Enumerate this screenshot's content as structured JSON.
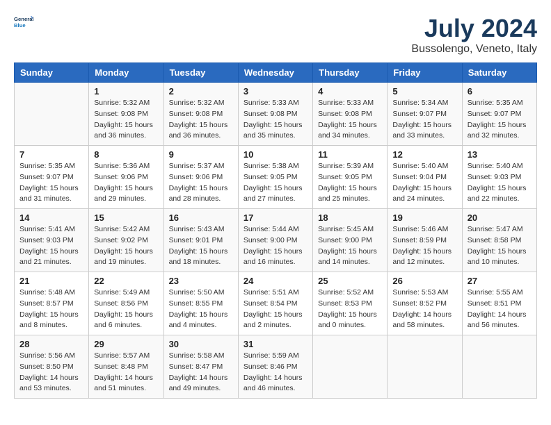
{
  "logo": {
    "line1": "General",
    "line2": "Blue"
  },
  "title": "July 2024",
  "location": "Bussolengo, Veneto, Italy",
  "days_header": [
    "Sunday",
    "Monday",
    "Tuesday",
    "Wednesday",
    "Thursday",
    "Friday",
    "Saturday"
  ],
  "weeks": [
    [
      {
        "day": "",
        "info": ""
      },
      {
        "day": "1",
        "info": "Sunrise: 5:32 AM\nSunset: 9:08 PM\nDaylight: 15 hours\nand 36 minutes."
      },
      {
        "day": "2",
        "info": "Sunrise: 5:32 AM\nSunset: 9:08 PM\nDaylight: 15 hours\nand 36 minutes."
      },
      {
        "day": "3",
        "info": "Sunrise: 5:33 AM\nSunset: 9:08 PM\nDaylight: 15 hours\nand 35 minutes."
      },
      {
        "day": "4",
        "info": "Sunrise: 5:33 AM\nSunset: 9:08 PM\nDaylight: 15 hours\nand 34 minutes."
      },
      {
        "day": "5",
        "info": "Sunrise: 5:34 AM\nSunset: 9:07 PM\nDaylight: 15 hours\nand 33 minutes."
      },
      {
        "day": "6",
        "info": "Sunrise: 5:35 AM\nSunset: 9:07 PM\nDaylight: 15 hours\nand 32 minutes."
      }
    ],
    [
      {
        "day": "7",
        "info": "Sunrise: 5:35 AM\nSunset: 9:07 PM\nDaylight: 15 hours\nand 31 minutes."
      },
      {
        "day": "8",
        "info": "Sunrise: 5:36 AM\nSunset: 9:06 PM\nDaylight: 15 hours\nand 29 minutes."
      },
      {
        "day": "9",
        "info": "Sunrise: 5:37 AM\nSunset: 9:06 PM\nDaylight: 15 hours\nand 28 minutes."
      },
      {
        "day": "10",
        "info": "Sunrise: 5:38 AM\nSunset: 9:05 PM\nDaylight: 15 hours\nand 27 minutes."
      },
      {
        "day": "11",
        "info": "Sunrise: 5:39 AM\nSunset: 9:05 PM\nDaylight: 15 hours\nand 25 minutes."
      },
      {
        "day": "12",
        "info": "Sunrise: 5:40 AM\nSunset: 9:04 PM\nDaylight: 15 hours\nand 24 minutes."
      },
      {
        "day": "13",
        "info": "Sunrise: 5:40 AM\nSunset: 9:03 PM\nDaylight: 15 hours\nand 22 minutes."
      }
    ],
    [
      {
        "day": "14",
        "info": "Sunrise: 5:41 AM\nSunset: 9:03 PM\nDaylight: 15 hours\nand 21 minutes."
      },
      {
        "day": "15",
        "info": "Sunrise: 5:42 AM\nSunset: 9:02 PM\nDaylight: 15 hours\nand 19 minutes."
      },
      {
        "day": "16",
        "info": "Sunrise: 5:43 AM\nSunset: 9:01 PM\nDaylight: 15 hours\nand 18 minutes."
      },
      {
        "day": "17",
        "info": "Sunrise: 5:44 AM\nSunset: 9:00 PM\nDaylight: 15 hours\nand 16 minutes."
      },
      {
        "day": "18",
        "info": "Sunrise: 5:45 AM\nSunset: 9:00 PM\nDaylight: 15 hours\nand 14 minutes."
      },
      {
        "day": "19",
        "info": "Sunrise: 5:46 AM\nSunset: 8:59 PM\nDaylight: 15 hours\nand 12 minutes."
      },
      {
        "day": "20",
        "info": "Sunrise: 5:47 AM\nSunset: 8:58 PM\nDaylight: 15 hours\nand 10 minutes."
      }
    ],
    [
      {
        "day": "21",
        "info": "Sunrise: 5:48 AM\nSunset: 8:57 PM\nDaylight: 15 hours\nand 8 minutes."
      },
      {
        "day": "22",
        "info": "Sunrise: 5:49 AM\nSunset: 8:56 PM\nDaylight: 15 hours\nand 6 minutes."
      },
      {
        "day": "23",
        "info": "Sunrise: 5:50 AM\nSunset: 8:55 PM\nDaylight: 15 hours\nand 4 minutes."
      },
      {
        "day": "24",
        "info": "Sunrise: 5:51 AM\nSunset: 8:54 PM\nDaylight: 15 hours\nand 2 minutes."
      },
      {
        "day": "25",
        "info": "Sunrise: 5:52 AM\nSunset: 8:53 PM\nDaylight: 15 hours\nand 0 minutes."
      },
      {
        "day": "26",
        "info": "Sunrise: 5:53 AM\nSunset: 8:52 PM\nDaylight: 14 hours\nand 58 minutes."
      },
      {
        "day": "27",
        "info": "Sunrise: 5:55 AM\nSunset: 8:51 PM\nDaylight: 14 hours\nand 56 minutes."
      }
    ],
    [
      {
        "day": "28",
        "info": "Sunrise: 5:56 AM\nSunset: 8:50 PM\nDaylight: 14 hours\nand 53 minutes."
      },
      {
        "day": "29",
        "info": "Sunrise: 5:57 AM\nSunset: 8:48 PM\nDaylight: 14 hours\nand 51 minutes."
      },
      {
        "day": "30",
        "info": "Sunrise: 5:58 AM\nSunset: 8:47 PM\nDaylight: 14 hours\nand 49 minutes."
      },
      {
        "day": "31",
        "info": "Sunrise: 5:59 AM\nSunset: 8:46 PM\nDaylight: 14 hours\nand 46 minutes."
      },
      {
        "day": "",
        "info": ""
      },
      {
        "day": "",
        "info": ""
      },
      {
        "day": "",
        "info": ""
      }
    ]
  ]
}
